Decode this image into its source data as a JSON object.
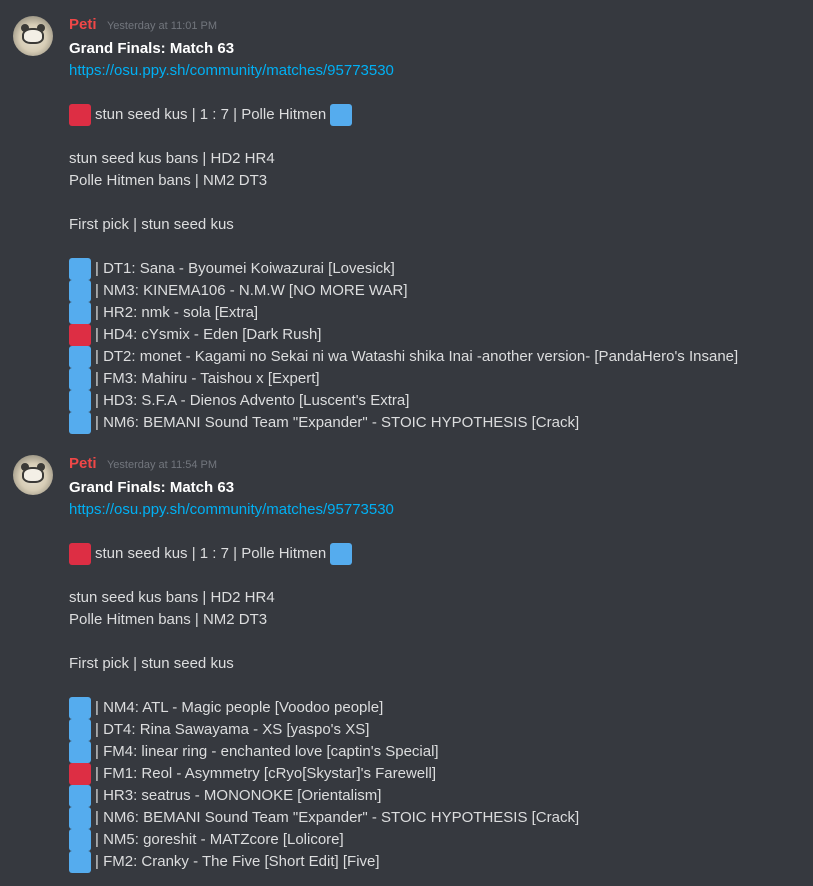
{
  "colors": {
    "background": "#36393f",
    "username": "#f04747",
    "link": "#00b0f4",
    "red_square": "#dd2e44",
    "blue_square": "#55acee"
  },
  "messages": [
    {
      "username": "Peti",
      "timestamp": "Yesterday at 11:01 PM",
      "title": "Grand Finals: Match 63",
      "link": "https://osu.ppy.sh/community/matches/95773530",
      "score_line": "stun seed kus | 1 : 7 | Polle Hitmen",
      "bans": [
        "stun seed kus bans | HD2 HR4",
        "Polle Hitmen bans | NM2 DT3"
      ],
      "first_pick": "First pick | stun seed kus",
      "picks": [
        {
          "winner": "blue",
          "text": "| DT1: Sana - Byoumei Koiwazurai [Lovesick]"
        },
        {
          "winner": "blue",
          "text": "| NM3: KINEMA106 - N.M.W [NO MORE WAR]"
        },
        {
          "winner": "blue",
          "text": "| HR2: nmk - sola [Extra]"
        },
        {
          "winner": "red",
          "text": "| HD4: cYsmix - Eden [Dark Rush]"
        },
        {
          "winner": "blue",
          "text": "| DT2: monet - Kagami no Sekai ni wa Watashi shika Inai -another version- [PandaHero's Insane]"
        },
        {
          "winner": "blue",
          "text": "| FM3: Mahiru - Taishou x [Expert]"
        },
        {
          "winner": "blue",
          "text": "| HD3: S.F.A - Dienos Advento [Luscent's Extra]"
        },
        {
          "winner": "blue",
          "text": "| NM6: BEMANI Sound Team \"Expander\" - STOIC HYPOTHESIS [Crack]"
        }
      ]
    },
    {
      "username": "Peti",
      "timestamp": "Yesterday at 11:54 PM",
      "title": "Grand Finals: Match 63",
      "link": "https://osu.ppy.sh/community/matches/95773530",
      "score_line": "stun seed kus | 1 : 7 | Polle Hitmen",
      "bans": [
        "stun seed kus bans | HD2 HR4",
        "Polle Hitmen bans | NM2 DT3"
      ],
      "first_pick": "First pick | stun seed kus",
      "picks": [
        {
          "winner": "blue",
          "text": "| NM4: ATL - Magic people [Voodoo people]"
        },
        {
          "winner": "blue",
          "text": "| DT4: Rina Sawayama - XS [yaspo's XS]"
        },
        {
          "winner": "blue",
          "text": "| FM4: linear ring - enchanted love [captin's Special]"
        },
        {
          "winner": "red",
          "text": "| FM1: Reol - Asymmetry [cRyo[Skystar]'s Farewell]"
        },
        {
          "winner": "blue",
          "text": "| HR3: seatrus - MONONOKE [Orientalism]"
        },
        {
          "winner": "blue",
          "text": "| NM6: BEMANI Sound Team \"Expander\" - STOIC HYPOTHESIS [Crack]"
        },
        {
          "winner": "blue",
          "text": "| NM5: goreshit - MATZcore [Lolicore]"
        },
        {
          "winner": "blue",
          "text": "| FM2: Cranky - The Five [Short Edit] [Five]"
        }
      ]
    }
  ]
}
